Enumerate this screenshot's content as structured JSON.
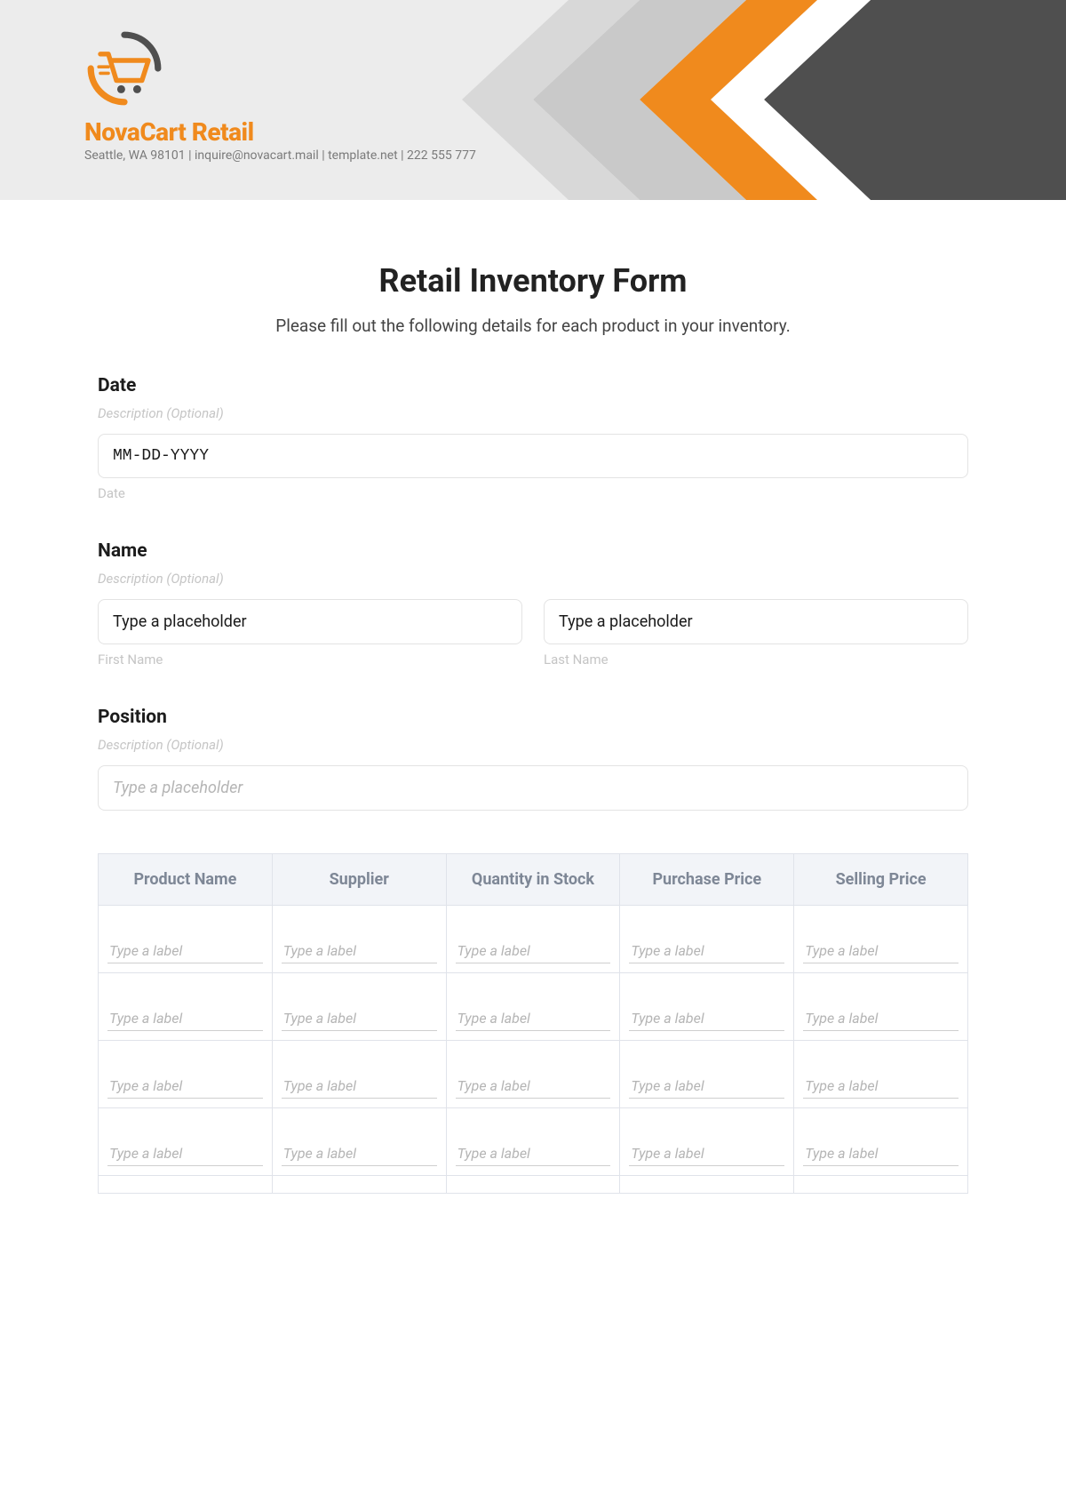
{
  "header": {
    "company_name": "NovaCart Retail",
    "contact_line": "Seattle, WA 98101 | inquire@novacart.mail | template.net | 222 555 777",
    "accent_color": "#f08a1d",
    "secondary_color": "#4f4f4f"
  },
  "form": {
    "title": "Retail Inventory Form",
    "subtitle": "Please fill out the following details for each product in your inventory."
  },
  "fields": {
    "date": {
      "label": "Date",
      "description": "Description (Optional)",
      "placeholder": "MM-DD-YYYY",
      "sublabel": "Date"
    },
    "name": {
      "label": "Name",
      "description": "Description (Optional)",
      "first_placeholder": "Type a placeholder",
      "first_sublabel": "First Name",
      "last_placeholder": "Type a placeholder",
      "last_sublabel": "Last Name"
    },
    "position": {
      "label": "Position",
      "description": "Description (Optional)",
      "placeholder": "Type a placeholder"
    }
  },
  "table": {
    "headers": [
      "Product Name",
      "Supplier",
      "Quantity in Stock",
      "Purchase Price",
      "Selling Price"
    ],
    "cell_placeholder": "Type a label",
    "row_count": 4
  }
}
